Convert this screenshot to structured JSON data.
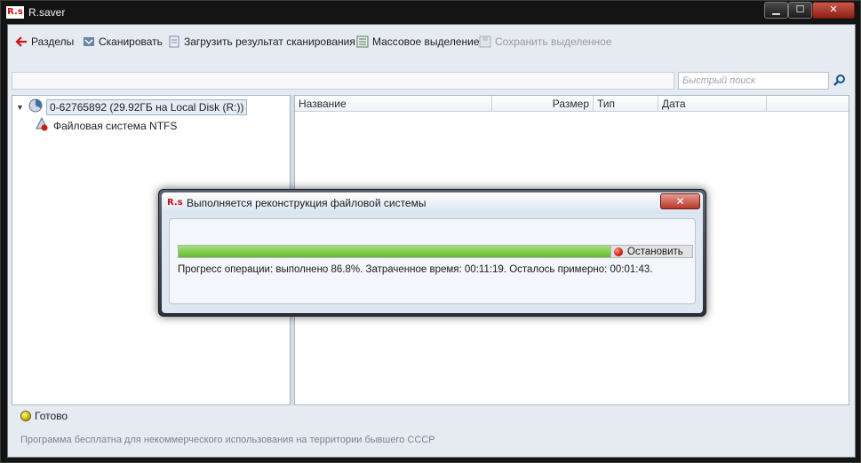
{
  "window": {
    "logo_text": "R.s",
    "title": "R.saver",
    "min_glyph": "▁",
    "max_glyph": "☐",
    "close_glyph": "✕"
  },
  "toolbar": {
    "partitions_label": "Разделы",
    "scan_label": "Сканировать",
    "load_scan_label": "Загрузить результат сканирования",
    "mass_select_label": "Массовое выделение",
    "save_selected_label": "Сохранить выделенное"
  },
  "search": {
    "placeholder": "Быстрый поиск"
  },
  "tree": {
    "disk_label": "0-62765892 (29.92ГБ на Local Disk (R:))",
    "filesystem_label": "Файловая система NTFS",
    "expand_glyph": "▼"
  },
  "list": {
    "columns": [
      "Название",
      "Размер",
      "Тип",
      "Дата"
    ]
  },
  "status": {
    "text": "Готово"
  },
  "footer": {
    "text": "Программа бесплатна для некоммерческого использования на территории бывшего СССР"
  },
  "dialog": {
    "logo_text": "R.s",
    "title": "Выполняется реконструкция файловой системы",
    "close_glyph": "✕",
    "progress_fraction": 0.868,
    "stop_label": "Остановить",
    "progress_text": "Прогресс операции: выполнено 86.8%. Затраченное время: 00:11:19. Осталось примерно: 00:01:43."
  },
  "colors": {
    "accent_red": "#d01010",
    "progress_green": "#62b92e",
    "status_yellow": "#c8b800"
  }
}
